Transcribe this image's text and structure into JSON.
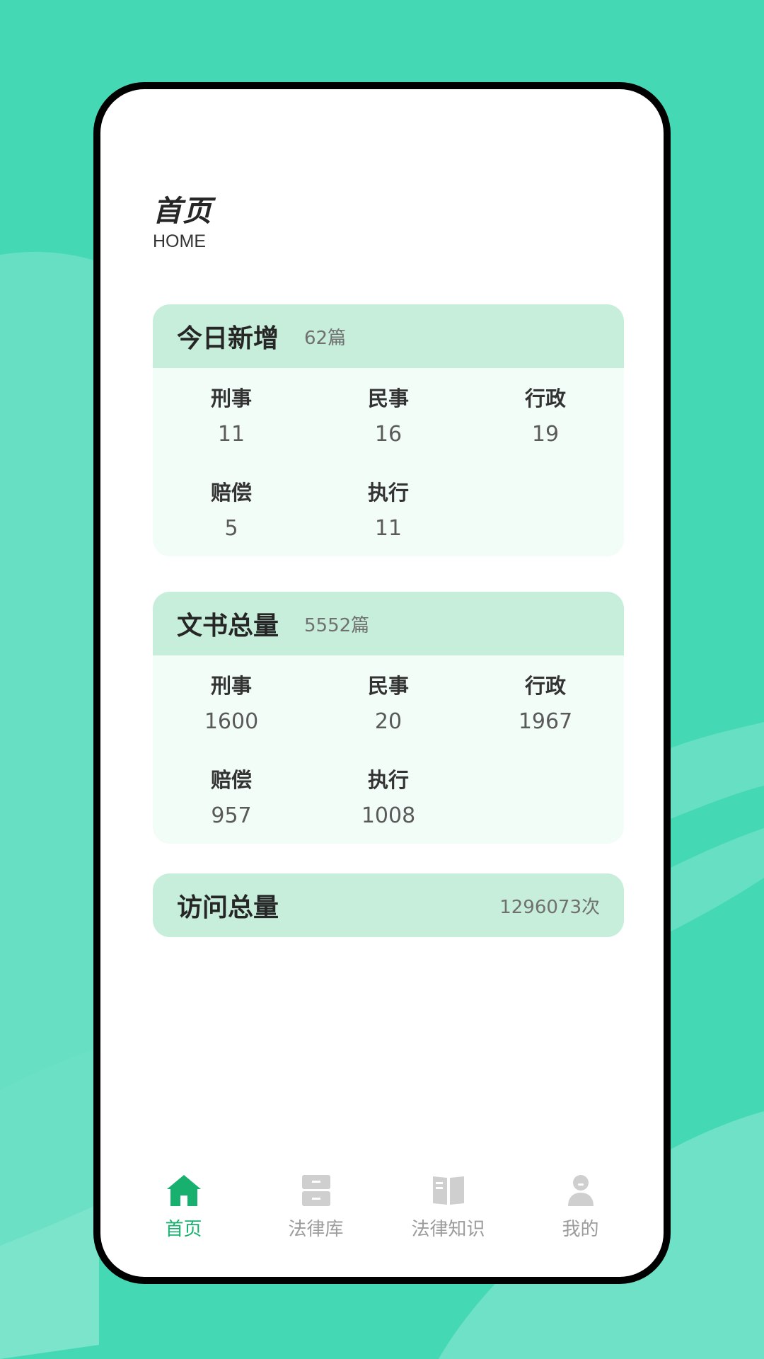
{
  "header": {
    "title": "首页",
    "subtitle": "HOME"
  },
  "today": {
    "title": "今日新增",
    "count": "62篇",
    "items": [
      {
        "label": "刑事",
        "value": "11"
      },
      {
        "label": "民事",
        "value": "16"
      },
      {
        "label": "行政",
        "value": "19"
      },
      {
        "label": "赔偿",
        "value": "5"
      },
      {
        "label": "执行",
        "value": "11"
      }
    ]
  },
  "total": {
    "title": "文书总量",
    "count": "5552篇",
    "items": [
      {
        "label": "刑事",
        "value": "1600"
      },
      {
        "label": "民事",
        "value": "20"
      },
      {
        "label": "行政",
        "value": "1967"
      },
      {
        "label": "赔偿",
        "value": "957"
      },
      {
        "label": "执行",
        "value": "1008"
      }
    ]
  },
  "visits": {
    "title": "访问总量",
    "count": "1296073次"
  },
  "tabbar": {
    "active_color": "#18b06e",
    "inactive_color": "#9c9c9c",
    "items": [
      {
        "label": "首页",
        "icon": "home-icon",
        "active": true
      },
      {
        "label": "法律库",
        "icon": "cabinet-icon",
        "active": false
      },
      {
        "label": "法律知识",
        "icon": "book-icon",
        "active": false
      },
      {
        "label": "我的",
        "icon": "user-icon",
        "active": false
      }
    ]
  }
}
